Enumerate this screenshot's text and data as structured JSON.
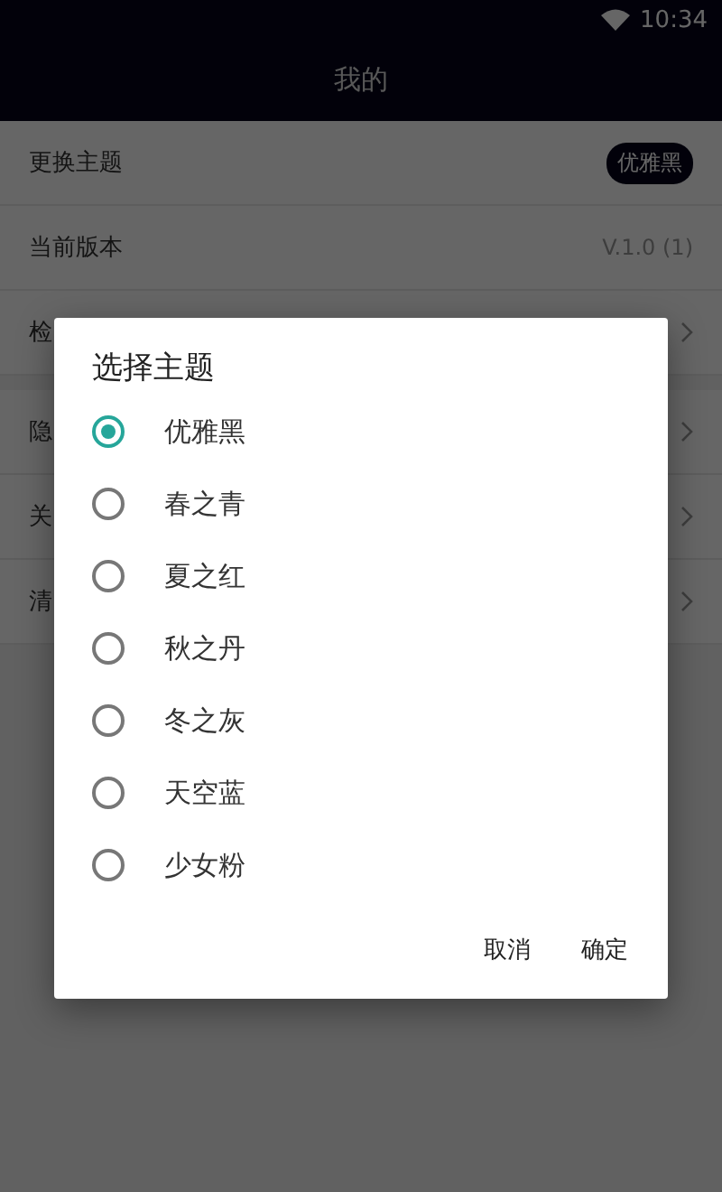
{
  "status_bar": {
    "time": "10:34"
  },
  "title": "我的",
  "settings": [
    {
      "kind": "badge",
      "label": "更换主题",
      "value": "优雅黑"
    },
    {
      "kind": "text",
      "label": "当前版本",
      "value": "V.1.0 (1)"
    },
    {
      "kind": "arrow",
      "label": "检"
    },
    {
      "kind": "arrow",
      "label": "隐",
      "group_start": true
    },
    {
      "kind": "arrow",
      "label": "关"
    },
    {
      "kind": "arrow",
      "label": "清"
    }
  ],
  "dialog": {
    "title": "选择主题",
    "options": [
      {
        "label": "优雅黑",
        "selected": true
      },
      {
        "label": "春之青",
        "selected": false
      },
      {
        "label": "夏之红",
        "selected": false
      },
      {
        "label": "秋之丹",
        "selected": false
      },
      {
        "label": "冬之灰",
        "selected": false
      },
      {
        "label": "天空蓝",
        "selected": false
      },
      {
        "label": "少女粉",
        "selected": false
      }
    ],
    "buttons": [
      "取消",
      "确定"
    ]
  }
}
